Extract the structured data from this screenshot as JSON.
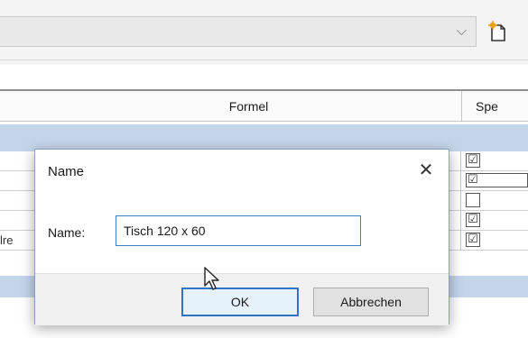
{
  "background": {
    "type_dropdown": {
      "value": ""
    },
    "grid": {
      "columns": [
        "Formel",
        "Spe"
      ],
      "rows": [
        {
          "left_text": "",
          "checked": true
        },
        {
          "left_text": "",
          "checked": true,
          "focused": true
        },
        {
          "left_text": "",
          "checked": false
        },
        {
          "left_text": "",
          "checked": true
        },
        {
          "left_text": "lre",
          "checked": true
        }
      ]
    }
  },
  "dialog": {
    "title": "Name",
    "close_glyph": "✕",
    "field_label": "Name:",
    "field_value": "Tisch 120 x 60",
    "ok_label": "OK",
    "cancel_label": "Abbrechen"
  },
  "icons": {
    "dropdown": "chevron-down-icon",
    "new_type": "new-type-icon",
    "close": "close-icon",
    "cursor": "mouse-cursor-icon"
  },
  "colors": {
    "accent": "#2f73c7",
    "group_band": "#c4d4ea"
  }
}
